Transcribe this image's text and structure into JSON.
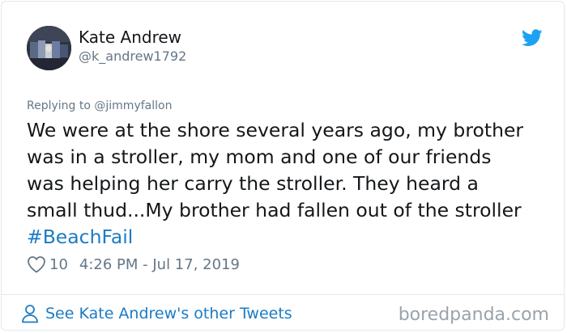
{
  "author": {
    "name": "Kate Andrew",
    "handle": "@k_andrew1792"
  },
  "reply": {
    "prefix": "Replying to",
    "target": "@jimmyfallon"
  },
  "tweet": {
    "lines": [
      "We were at the shore several years ago, my brother",
      "was in a stroller, my mom and one of our friends",
      "was helping her carry the stroller. They heard a",
      "small thud...My brother had fallen out of the stroller"
    ],
    "hashtag": "#BeachFail"
  },
  "meta": {
    "likes": "10",
    "timestamp": "4:26 PM - Jul 17, 2019"
  },
  "footer": {
    "see_more": "See Kate Andrew's other Tweets",
    "watermark": "boredpanda.com"
  },
  "icons": {
    "brand": "twitter-bird-icon",
    "like": "heart-icon",
    "profile": "person-icon"
  },
  "colors": {
    "link": "#1b7bc4",
    "twitter_blue": "#1da1f2",
    "muted": "#657786",
    "text": "#14171a"
  }
}
